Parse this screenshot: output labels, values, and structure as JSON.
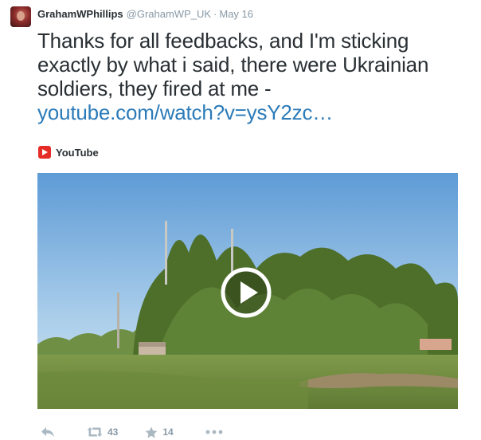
{
  "tweet": {
    "author_name": "GrahamWPhillips",
    "author_handle": "@GrahamWP_UK",
    "separator": "·",
    "timestamp": "May 16",
    "text": "Thanks for all feedbacks, and I'm sticking exactly by what i said, there were Ukrainian soldiers, they fired at me -",
    "link_text": "youtube.com/watch?v=ysY2zc…"
  },
  "card": {
    "source_label": "YouTube",
    "source_icon": "youtube-icon",
    "play_icon": "play-icon"
  },
  "actions": {
    "reply_icon": "reply-icon",
    "retweet_icon": "retweet-icon",
    "retweet_count": "43",
    "favorite_icon": "star-icon",
    "favorite_count": "14",
    "more_icon": "more-icon"
  },
  "colors": {
    "link": "#2b7bb9",
    "muted": "#8899a6",
    "youtube_red": "#e52d27",
    "text": "#292f33"
  }
}
